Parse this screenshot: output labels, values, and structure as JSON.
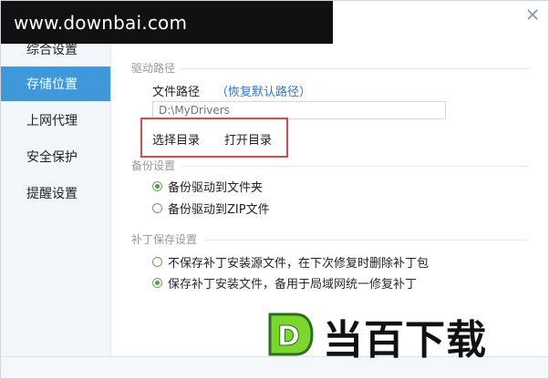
{
  "watermark": {
    "text": "www.downbai.com"
  },
  "sidebar": {
    "items": [
      {
        "label": "综合设置"
      },
      {
        "label": "存储位置"
      },
      {
        "label": "上网代理"
      },
      {
        "label": "安全保护"
      },
      {
        "label": "提醒设置"
      }
    ]
  },
  "sections": {
    "driver_path": {
      "title": "驱动路径",
      "field_label": "文件路径",
      "restore_link": "（恢复默认路径）",
      "input_placeholder": "D:\\MyDrivers",
      "input_value": "",
      "select_dir_button": "选择目录",
      "open_dir_button": "打开目录"
    },
    "backup_settings": {
      "title": "备份设置",
      "options": [
        {
          "label": "备份驱动到文件夹"
        },
        {
          "label": "备份驱动到ZIP文件"
        }
      ]
    },
    "patch_storage": {
      "title": "补丁保存设置",
      "options": [
        {
          "label": "不保存补丁安装源文件，在下次修复时删除补丁包"
        },
        {
          "label": "保存补丁安装文件，备用于局域网统一修复补丁"
        }
      ]
    }
  },
  "logo": {
    "mark_text": "D",
    "brand_text": "当百下载"
  },
  "colors": {
    "accent": "#3f98da",
    "link": "#2f77c9",
    "highlight": "#d84b4b",
    "radio": "#49a33a",
    "logo_green": "#7bd72c"
  },
  "icons": {
    "close": "close-icon",
    "radio": "radio-button-icon",
    "brand": "logo-icon"
  }
}
